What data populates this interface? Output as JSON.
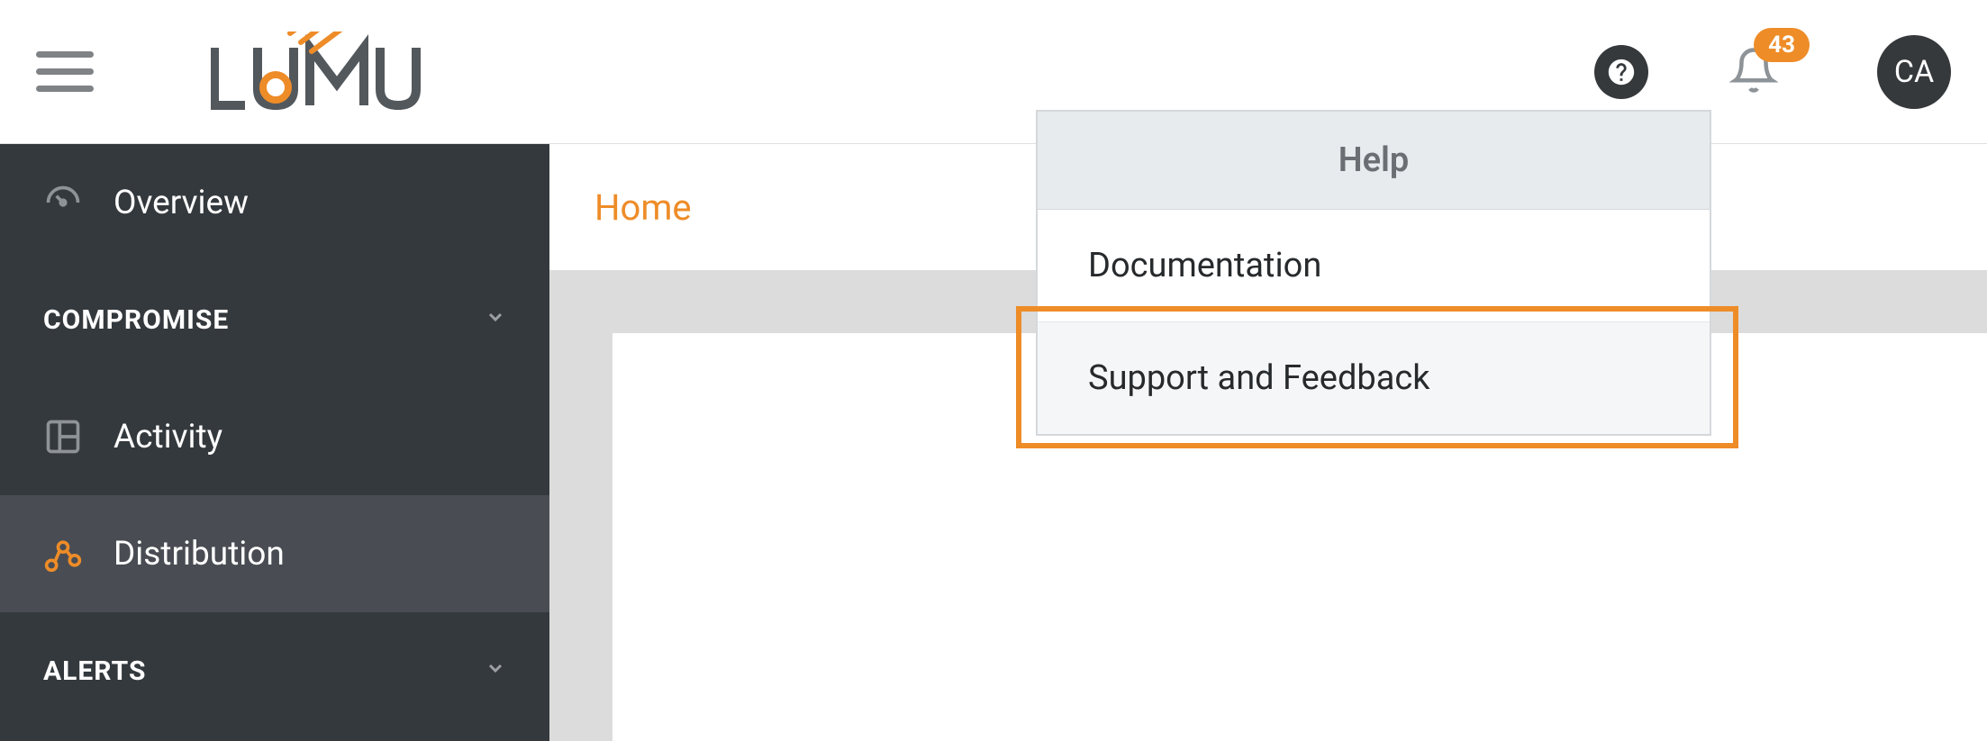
{
  "topbar": {
    "logo_text": "LUMU",
    "notification_count": "43",
    "avatar_initials": "CA"
  },
  "sidebar": {
    "overview_label": "Overview",
    "compromise_label": "COMPROMISE",
    "activity_label": "Activity",
    "distribution_label": "Distribution",
    "alerts_label": "ALERTS"
  },
  "breadcrumb": {
    "home": "Home"
  },
  "help_menu": {
    "title": "Help",
    "documentation": "Documentation",
    "support_feedback": "Support and Feedback"
  }
}
